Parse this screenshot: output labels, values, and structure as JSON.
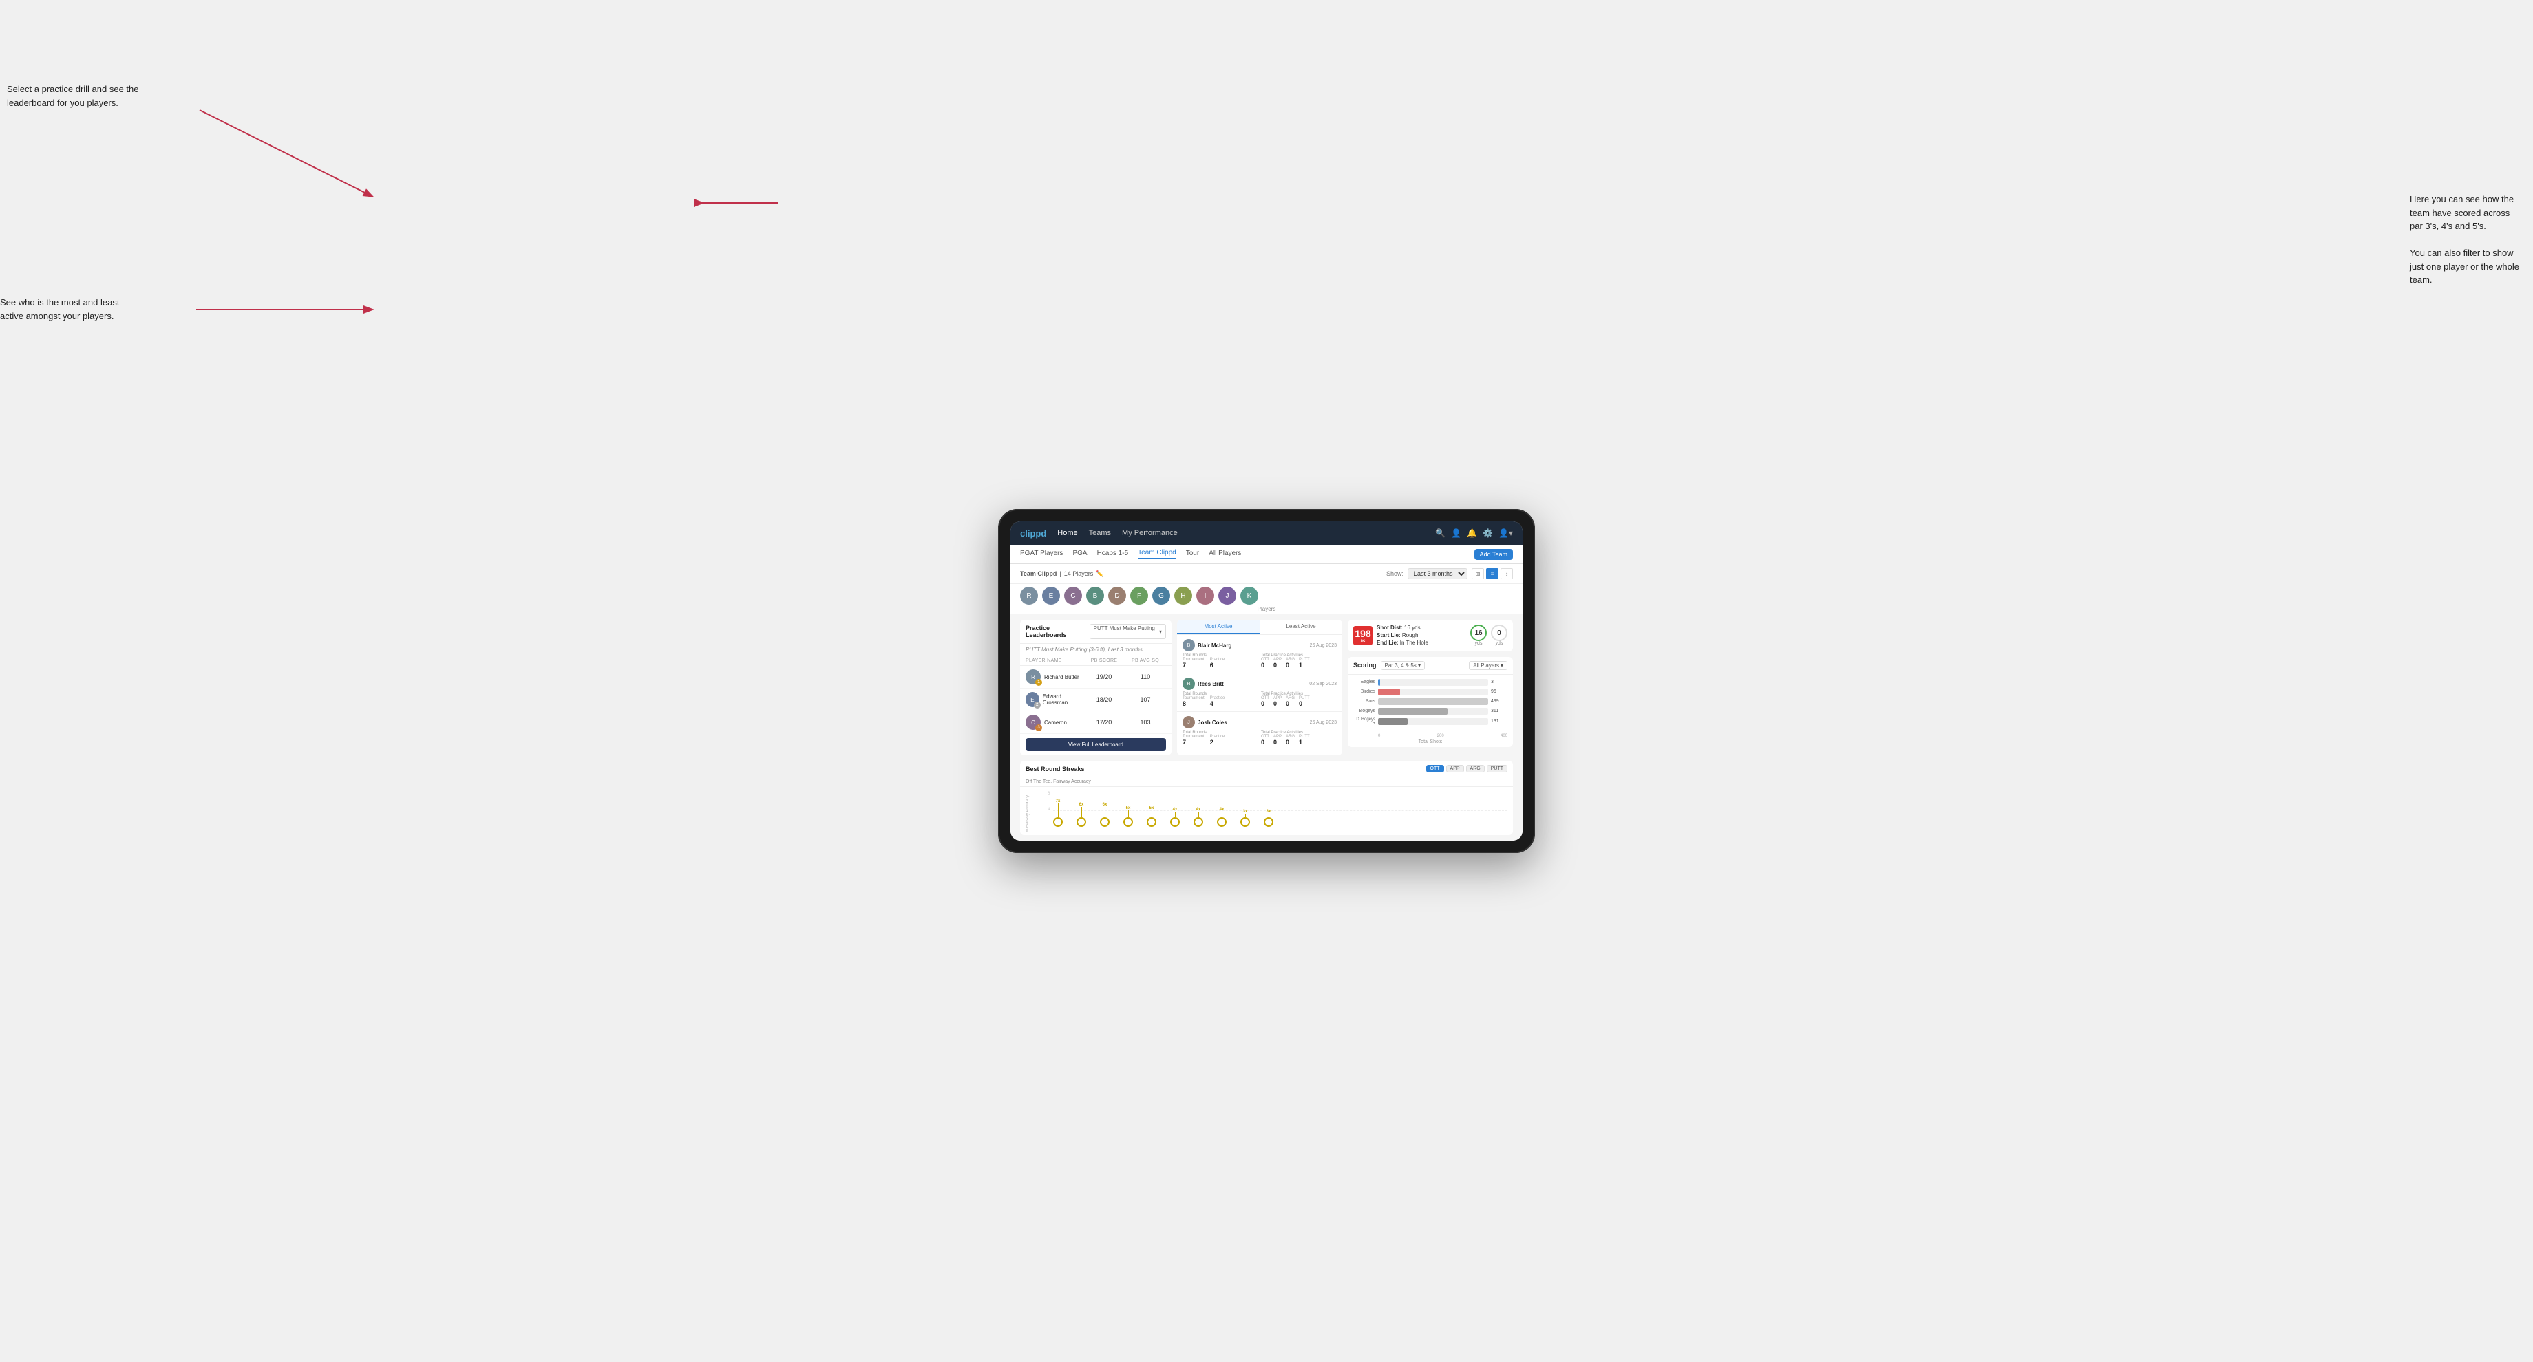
{
  "annotations": {
    "top_left": "Select a practice drill and see the leaderboard for you players.",
    "bottom_left": "See who is the most and least active amongst your players.",
    "top_right_line1": "Here you can see how the",
    "top_right_line2": "team have scored across",
    "top_right_line3": "par 3's, 4's and 5's.",
    "bottom_right_line1": "You can also filter to show",
    "bottom_right_line2": "just one player or the whole",
    "bottom_right_line3": "team."
  },
  "nav": {
    "logo": "clippd",
    "items": [
      "Home",
      "Teams",
      "My Performance"
    ],
    "active": "Teams"
  },
  "subnav": {
    "items": [
      "PGAT Players",
      "PGA",
      "Hcaps 1-5",
      "Team Clippd",
      "Tour",
      "All Players"
    ],
    "active": "Team Clippd",
    "add_team_btn": "Add Team"
  },
  "team": {
    "name": "Team Clippd",
    "players_count": "14 Players",
    "show_label": "Show:",
    "show_value": "Last 3 months",
    "player_avatars": [
      "R",
      "E",
      "C",
      "B",
      "D",
      "F",
      "G",
      "H",
      "I",
      "J",
      "K"
    ],
    "players_label": "Players"
  },
  "shot_info": {
    "distance": "198",
    "unit": "sc",
    "shot_dist_label": "Shot Dist:",
    "shot_dist_val": "16 yds",
    "start_lie_label": "Start Lie:",
    "start_lie_val": "Rough",
    "end_lie_label": "End Lie:",
    "end_lie_val": "In The Hole",
    "yds_val": "16",
    "yds_label": "yds",
    "zero_val": "0",
    "zero_label": "yds"
  },
  "practice_leaderboard": {
    "title": "Practice Leaderboards",
    "filter": "PUTT Must Make Putting ...",
    "subtitle": "PUTT Must Make Putting (3-6 ft),",
    "subtitle_period": "Last 3 months",
    "col_player": "PLAYER NAME",
    "col_score": "PB SCORE",
    "col_avg": "PB AVG SQ",
    "players": [
      {
        "name": "Richard Butler",
        "score": "19/20",
        "avg": "110",
        "badge": "gold",
        "badge_num": "1"
      },
      {
        "name": "Edward Crossman",
        "score": "18/20",
        "avg": "107",
        "badge": "silver",
        "badge_num": "2"
      },
      {
        "name": "Cameron...",
        "score": "17/20",
        "avg": "103",
        "badge": "bronze",
        "badge_num": "3"
      }
    ],
    "view_btn": "View Full Leaderboard"
  },
  "activity": {
    "tabs": [
      "Most Active",
      "Least Active"
    ],
    "active_tab": "Most Active",
    "items": [
      {
        "name": "Blair McHarg",
        "date": "26 Aug 2023",
        "total_rounds_label": "Total Rounds",
        "tournament_label": "Tournament",
        "practice_label": "Practice",
        "tournament_val": "7",
        "practice_val": "6",
        "total_practice_label": "Total Practice Activities",
        "ott_label": "OTT",
        "app_label": "APP",
        "arg_label": "ARG",
        "putt_label": "PUTT",
        "ott_val": "0",
        "app_val": "0",
        "arg_val": "0",
        "putt_val": "1"
      },
      {
        "name": "Rees Britt",
        "date": "02 Sep 2023",
        "total_rounds_label": "Total Rounds",
        "tournament_label": "Tournament",
        "practice_label": "Practice",
        "tournament_val": "8",
        "practice_val": "4",
        "total_practice_label": "Total Practice Activities",
        "ott_label": "OTT",
        "app_label": "APP",
        "arg_label": "ARG",
        "putt_label": "PUTT",
        "ott_val": "0",
        "app_val": "0",
        "arg_val": "0",
        "putt_val": "0"
      },
      {
        "name": "Josh Coles",
        "date": "26 Aug 2023",
        "total_rounds_label": "Total Rounds",
        "tournament_label": "Tournament",
        "practice_label": "Practice",
        "tournament_val": "7",
        "practice_val": "2",
        "total_practice_label": "Total Practice Activities",
        "ott_label": "OTT",
        "app_label": "APP",
        "arg_label": "ARG",
        "putt_label": "PUTT",
        "ott_val": "0",
        "app_val": "0",
        "arg_val": "0",
        "putt_val": "1"
      }
    ]
  },
  "scoring": {
    "title": "Scoring",
    "par_filter": "Par 3, 4 & 5s",
    "all_players_filter": "All Players",
    "bars": [
      {
        "label": "Eagles",
        "val": "3",
        "pct": 2,
        "color": "#4a90d9"
      },
      {
        "label": "Birdies",
        "val": "96",
        "pct": 20,
        "color": "#e07070"
      },
      {
        "label": "Pars",
        "val": "499",
        "pct": 100,
        "color": "#cccccc"
      },
      {
        "label": "Bogeys",
        "val": "311",
        "pct": 63,
        "color": "#aaaaaa"
      },
      {
        "label": "D. Bogeys +",
        "val": "131",
        "pct": 26,
        "color": "#888888"
      }
    ],
    "x_labels": [
      "0",
      "200",
      "400"
    ],
    "x_axis_title": "Total Shots"
  },
  "streaks": {
    "title": "Best Round Streaks",
    "filters": [
      "OTT",
      "APP",
      "ARG",
      "PUTT"
    ],
    "active_filter": "OTT",
    "subtitle": "Off The Tee, Fairway Accuracy",
    "y_label": "% Fairway Accuracy",
    "dots": [
      "7x",
      "6x",
      "6x",
      "5x",
      "5x",
      "4x",
      "4x",
      "4x",
      "3x",
      "3x"
    ]
  }
}
